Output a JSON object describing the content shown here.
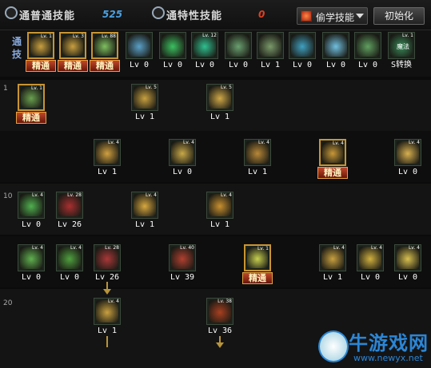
{
  "header": {
    "tab_normal": "通普通技能",
    "points": "525",
    "tab_special": "通特性技能",
    "special_points": "0",
    "dropdown_label": "偷学技能",
    "reset_button": "初始化"
  },
  "strip": {
    "side_label": "通技",
    "slots": [
      {
        "lv": "Lv. 1",
        "label": "精通",
        "mastered": true,
        "color": "#c8a040"
      },
      {
        "lv": "Lv. 3",
        "label": "精通",
        "mastered": true,
        "color": "#c8a040"
      },
      {
        "lv": "Lv. 88",
        "label": "精通",
        "mastered": true,
        "color": "#7fc060"
      },
      {
        "lv": "",
        "label": "Lv 0",
        "mastered": false,
        "color": "#5aa0c8"
      },
      {
        "lv": "",
        "label": "Lv 0",
        "mastered": false,
        "color": "#3cc060"
      },
      {
        "lv": "Lv. 12",
        "label": "Lv 0",
        "mastered": false,
        "color": "#30c090"
      },
      {
        "lv": "",
        "label": "Lv 0",
        "mastered": false,
        "color": "#6aa070"
      },
      {
        "lv": "",
        "label": "Lv 1",
        "mastered": false,
        "color": "#7a9a6a"
      },
      {
        "lv": "",
        "label": "Lv 0",
        "mastered": false,
        "color": "#40a0c0"
      },
      {
        "lv": "",
        "label": "Lv 0",
        "mastered": false,
        "color": "#70c0e0"
      },
      {
        "lv": "",
        "label": "Lv 0",
        "mastered": false,
        "color": "#60a060"
      },
      {
        "lv": "Lv. 1",
        "label": "S转换",
        "mastered": false,
        "color": "#3a8a5a",
        "sub": "魔法"
      }
    ]
  },
  "rows": [
    {
      "level": "1",
      "cells": [
        {
          "label": "精通",
          "mastered": true,
          "color": "#6aa050",
          "tag": "Lv. 1"
        },
        {
          "label": "Lv 1",
          "color": "#c8a040",
          "tag": "Lv. 5"
        },
        {
          "label": "Lv 1",
          "color": "#d0a848",
          "tag": "Lv. 5"
        }
      ]
    },
    {
      "level": "",
      "cells": [
        {
          "label": "Lv 1",
          "color": "#d0a040",
          "tag": "Lv. 4"
        },
        {
          "label": "Lv 0",
          "color": "#c8a848",
          "tag": "Lv. 4"
        },
        {
          "label": "Lv 1",
          "color": "#b88838",
          "tag": "Lv. 4"
        },
        {
          "label": "精通",
          "mastered": true,
          "color": "#c89838",
          "tag": "Lv. 4"
        },
        {
          "label": "Lv 0",
          "color": "#d8b050",
          "tag": "Lv. 4"
        }
      ]
    },
    {
      "level": "10",
      "cells": [
        {
          "label": "Lv 0",
          "color": "#50b050",
          "tag": "Lv. 4"
        },
        {
          "label": "Lv 26",
          "color": "#a83030",
          "tag": "Lv. 28"
        },
        {
          "label": "Lv 1",
          "color": "#d8a840",
          "tag": "Lv. 4"
        },
        {
          "label": "Lv 1",
          "color": "#c89030",
          "tag": "Lv. 4"
        }
      ]
    },
    {
      "level": "",
      "cells": [
        {
          "label": "Lv 0",
          "color": "#60b050",
          "tag": "Lv. 4"
        },
        {
          "label": "Lv 0",
          "color": "#50a040",
          "tag": "Lv. 4"
        },
        {
          "label": "Lv 26",
          "color": "#a83838",
          "tag": "Lv. 28"
        },
        {
          "label": "Lv 39",
          "color": "#b04030",
          "tag": "Lv. 40"
        },
        {
          "label": "精通",
          "mastered": true,
          "color": "#c8d050",
          "tag": "Lv. 1"
        },
        {
          "label": "Lv 1",
          "color": "#c8a040",
          "tag": "Lv. 4"
        },
        {
          "label": "Lv 0",
          "color": "#d0b040",
          "tag": "Lv. 4"
        },
        {
          "label": "Lv 0",
          "color": "#d8c050",
          "tag": "Lv. 4"
        }
      ]
    },
    {
      "level": "20",
      "cells": [
        {
          "label": "Lv 1",
          "color": "#c8a040",
          "tag": "Lv. 4"
        },
        {
          "label": "Lv 36",
          "color": "#a84020",
          "tag": "Lv. 38"
        }
      ]
    }
  ],
  "watermark": {
    "title": "牛游戏网",
    "url": "www.newyx.net"
  }
}
